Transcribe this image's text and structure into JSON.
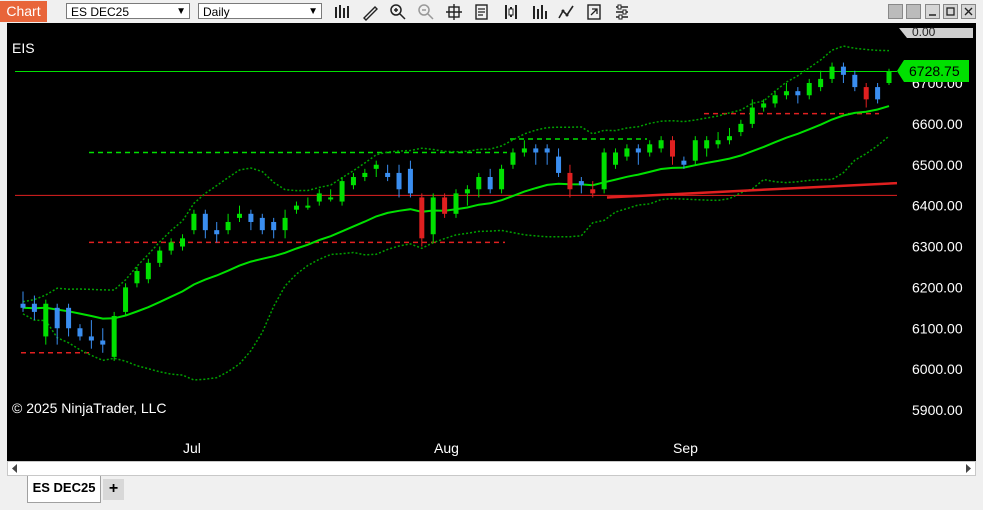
{
  "toolbar": {
    "chart_label": "Chart",
    "instrument": "ES DEC25",
    "interval": "Daily",
    "icons": [
      "bar-type-icon",
      "drawing-tool-icon",
      "zoom-in-icon",
      "zoom-out-icon",
      "crosshair-icon",
      "data-box-icon",
      "instrument-properties-icon",
      "indicators-icon",
      "strategies-icon",
      "chart-trader-icon",
      "properties-icon"
    ]
  },
  "chart": {
    "label": "EIS",
    "copyright": "© 2025 NinjaTrader, LLC",
    "price_labels": [
      "6700.00",
      "6600.00",
      "6500.00",
      "6400.00",
      "6300.00",
      "6200.00",
      "6100.00",
      "6000.00",
      "5900.00"
    ],
    "top_partial_label": "0.00",
    "current_price": "6728.75",
    "month_labels": [
      "Jul",
      "Aug",
      "Sep"
    ],
    "colors": {
      "up": "#00e000",
      "down": "#e02020",
      "down_alt": "#3a8ef0",
      "ma": "#00e000",
      "slow_ma": "#e02020",
      "price_tag": "#00e000"
    }
  },
  "chart_data": {
    "type": "candlestick",
    "ylim": [
      5870,
      6760
    ],
    "ticks": [
      5900,
      6000,
      6100,
      6200,
      6300,
      6400,
      6500,
      6600,
      6700
    ],
    "x_labels": [
      "Jul",
      "Aug",
      "Sep"
    ],
    "last_price": 6728.75,
    "horizontal_levels": [
      {
        "value": 6728,
        "style": "solid",
        "color": "#00e000"
      },
      {
        "value": 6425,
        "style": "solid",
        "color": "#e02020"
      },
      {
        "value": 6310,
        "style": "dashed",
        "color": "#e02020"
      },
      {
        "value": 6530,
        "style": "dashed",
        "color": "#00e000"
      },
      {
        "value": 6040,
        "style": "dashed",
        "color": "#e02020"
      },
      {
        "value": 6625,
        "style": "dashed",
        "color": "#e02020"
      },
      {
        "value": 6563,
        "style": "dashed",
        "color": "#00e000"
      }
    ],
    "candles": [
      {
        "o": 6160,
        "c": 6150,
        "h": 6190,
        "l": 6140,
        "dir": "down"
      },
      {
        "o": 6160,
        "c": 6140,
        "h": 6180,
        "l": 6120,
        "dir": "down"
      },
      {
        "o": 6080,
        "c": 6160,
        "h": 6170,
        "l": 6060,
        "dir": "up"
      },
      {
        "o": 6150,
        "c": 6100,
        "h": 6160,
        "l": 6060,
        "dir": "down"
      },
      {
        "o": 6150,
        "c": 6100,
        "h": 6160,
        "l": 6080,
        "dir": "down"
      },
      {
        "o": 6100,
        "c": 6080,
        "h": 6110,
        "l": 6070,
        "dir": "down"
      },
      {
        "o": 6080,
        "c": 6070,
        "h": 6120,
        "l": 6050,
        "dir": "down"
      },
      {
        "o": 6070,
        "c": 6060,
        "h": 6100,
        "l": 6040,
        "dir": "down"
      },
      {
        "o": 6030,
        "c": 6130,
        "h": 6140,
        "l": 6020,
        "dir": "up"
      },
      {
        "o": 6140,
        "c": 6200,
        "h": 6210,
        "l": 6130,
        "dir": "up"
      },
      {
        "o": 6210,
        "c": 6240,
        "h": 6250,
        "l": 6200,
        "dir": "up"
      },
      {
        "o": 6220,
        "c": 6260,
        "h": 6270,
        "l": 6210,
        "dir": "up"
      },
      {
        "o": 6260,
        "c": 6290,
        "h": 6300,
        "l": 6250,
        "dir": "up"
      },
      {
        "o": 6290,
        "c": 6310,
        "h": 6320,
        "l": 6280,
        "dir": "up"
      },
      {
        "o": 6300,
        "c": 6320,
        "h": 6330,
        "l": 6290,
        "dir": "up"
      },
      {
        "o": 6340,
        "c": 6380,
        "h": 6390,
        "l": 6330,
        "dir": "up"
      },
      {
        "o": 6380,
        "c": 6340,
        "h": 6390,
        "l": 6320,
        "dir": "down"
      },
      {
        "o": 6340,
        "c": 6330,
        "h": 6360,
        "l": 6310,
        "dir": "down"
      },
      {
        "o": 6340,
        "c": 6360,
        "h": 6380,
        "l": 6330,
        "dir": "up"
      },
      {
        "o": 6370,
        "c": 6380,
        "h": 6400,
        "l": 6360,
        "dir": "up"
      },
      {
        "o": 6380,
        "c": 6360,
        "h": 6390,
        "l": 6340,
        "dir": "down"
      },
      {
        "o": 6370,
        "c": 6340,
        "h": 6380,
        "l": 6330,
        "dir": "down"
      },
      {
        "o": 6360,
        "c": 6340,
        "h": 6370,
        "l": 6320,
        "dir": "down"
      },
      {
        "o": 6340,
        "c": 6370,
        "h": 6390,
        "l": 6320,
        "dir": "up"
      },
      {
        "o": 6390,
        "c": 6400,
        "h": 6410,
        "l": 6380,
        "dir": "up"
      },
      {
        "o": 6400,
        "c": 6400,
        "h": 6420,
        "l": 6390,
        "dir": "up"
      },
      {
        "o": 6410,
        "c": 6430,
        "h": 6440,
        "l": 6400,
        "dir": "up"
      },
      {
        "o": 6420,
        "c": 6420,
        "h": 6440,
        "l": 6410,
        "dir": "up"
      },
      {
        "o": 6410,
        "c": 6460,
        "h": 6470,
        "l": 6400,
        "dir": "up"
      },
      {
        "o": 6450,
        "c": 6470,
        "h": 6480,
        "l": 6440,
        "dir": "up"
      },
      {
        "o": 6470,
        "c": 6480,
        "h": 6490,
        "l": 6460,
        "dir": "up"
      },
      {
        "o": 6490,
        "c": 6500,
        "h": 6510,
        "l": 6470,
        "dir": "up"
      },
      {
        "o": 6480,
        "c": 6470,
        "h": 6500,
        "l": 6460,
        "dir": "down"
      },
      {
        "o": 6480,
        "c": 6440,
        "h": 6500,
        "l": 6420,
        "dir": "down"
      },
      {
        "o": 6490,
        "c": 6430,
        "h": 6510,
        "l": 6420,
        "dir": "down"
      },
      {
        "o": 6420,
        "c": 6320,
        "h": 6430,
        "l": 6300,
        "dir": "down_red"
      },
      {
        "o": 6330,
        "c": 6420,
        "h": 6430,
        "l": 6310,
        "dir": "up"
      },
      {
        "o": 6420,
        "c": 6380,
        "h": 6430,
        "l": 6370,
        "dir": "down_red"
      },
      {
        "o": 6380,
        "c": 6430,
        "h": 6440,
        "l": 6370,
        "dir": "up"
      },
      {
        "o": 6430,
        "c": 6440,
        "h": 6450,
        "l": 6400,
        "dir": "up"
      },
      {
        "o": 6440,
        "c": 6470,
        "h": 6480,
        "l": 6420,
        "dir": "up"
      },
      {
        "o": 6470,
        "c": 6440,
        "h": 6490,
        "l": 6430,
        "dir": "down"
      },
      {
        "o": 6440,
        "c": 6490,
        "h": 6500,
        "l": 6430,
        "dir": "up"
      },
      {
        "o": 6500,
        "c": 6530,
        "h": 6540,
        "l": 6490,
        "dir": "up"
      },
      {
        "o": 6530,
        "c": 6540,
        "h": 6560,
        "l": 6520,
        "dir": "up"
      },
      {
        "o": 6540,
        "c": 6530,
        "h": 6550,
        "l": 6500,
        "dir": "down"
      },
      {
        "o": 6540,
        "c": 6530,
        "h": 6550,
        "l": 6500,
        "dir": "down"
      },
      {
        "o": 6520,
        "c": 6480,
        "h": 6540,
        "l": 6470,
        "dir": "down"
      },
      {
        "o": 6480,
        "c": 6440,
        "h": 6500,
        "l": 6420,
        "dir": "down_red"
      },
      {
        "o": 6460,
        "c": 6450,
        "h": 6470,
        "l": 6430,
        "dir": "down"
      },
      {
        "o": 6440,
        "c": 6430,
        "h": 6460,
        "l": 6420,
        "dir": "down_red"
      },
      {
        "o": 6440,
        "c": 6530,
        "h": 6540,
        "l": 6430,
        "dir": "up"
      },
      {
        "o": 6500,
        "c": 6530,
        "h": 6540,
        "l": 6490,
        "dir": "up"
      },
      {
        "o": 6520,
        "c": 6540,
        "h": 6550,
        "l": 6510,
        "dir": "up"
      },
      {
        "o": 6540,
        "c": 6530,
        "h": 6550,
        "l": 6500,
        "dir": "down"
      },
      {
        "o": 6530,
        "c": 6550,
        "h": 6560,
        "l": 6520,
        "dir": "up"
      },
      {
        "o": 6540,
        "c": 6560,
        "h": 6570,
        "l": 6530,
        "dir": "up"
      },
      {
        "o": 6560,
        "c": 6520,
        "h": 6570,
        "l": 6500,
        "dir": "down_red"
      },
      {
        "o": 6510,
        "c": 6500,
        "h": 6520,
        "l": 6490,
        "dir": "down"
      },
      {
        "o": 6510,
        "c": 6560,
        "h": 6570,
        "l": 6500,
        "dir": "up"
      },
      {
        "o": 6540,
        "c": 6560,
        "h": 6570,
        "l": 6520,
        "dir": "up"
      },
      {
        "o": 6550,
        "c": 6560,
        "h": 6580,
        "l": 6540,
        "dir": "up"
      },
      {
        "o": 6560,
        "c": 6570,
        "h": 6590,
        "l": 6550,
        "dir": "up"
      },
      {
        "o": 6580,
        "c": 6600,
        "h": 6610,
        "l": 6570,
        "dir": "up"
      },
      {
        "o": 6600,
        "c": 6640,
        "h": 6660,
        "l": 6590,
        "dir": "up"
      },
      {
        "o": 6640,
        "c": 6650,
        "h": 6660,
        "l": 6630,
        "dir": "up"
      },
      {
        "o": 6650,
        "c": 6670,
        "h": 6680,
        "l": 6640,
        "dir": "up"
      },
      {
        "o": 6670,
        "c": 6680,
        "h": 6700,
        "l": 6660,
        "dir": "up"
      },
      {
        "o": 6680,
        "c": 6670,
        "h": 6690,
        "l": 6650,
        "dir": "down"
      },
      {
        "o": 6670,
        "c": 6700,
        "h": 6710,
        "l": 6660,
        "dir": "up"
      },
      {
        "o": 6690,
        "c": 6710,
        "h": 6730,
        "l": 6680,
        "dir": "up"
      },
      {
        "o": 6710,
        "c": 6740,
        "h": 6750,
        "l": 6700,
        "dir": "up"
      },
      {
        "o": 6740,
        "c": 6720,
        "h": 6750,
        "l": 6700,
        "dir": "down"
      },
      {
        "o": 6720,
        "c": 6690,
        "h": 6730,
        "l": 6680,
        "dir": "down"
      },
      {
        "o": 6690,
        "c": 6660,
        "h": 6700,
        "l": 6640,
        "dir": "down_red"
      },
      {
        "o": 6660,
        "c": 6690,
        "h": 6700,
        "l": 6650,
        "dir": "down"
      },
      {
        "o": 6700,
        "c": 6728,
        "h": 6735,
        "l": 6695,
        "dir": "up"
      }
    ]
  }
}
